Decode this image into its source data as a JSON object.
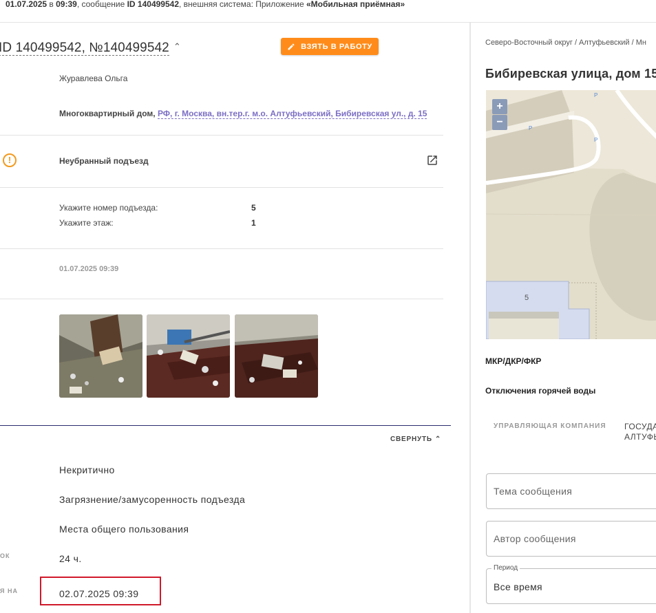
{
  "topbar": {
    "date": "01.07.2025",
    "in": " в ",
    "time": "09:39",
    "msg": ", сообщение ",
    "id": "ID 140499542",
    "ext": ", внешняя система: Приложение ",
    "system": "«Мобильная приёмная»"
  },
  "header": {
    "title": "ID 140499542, №140499542",
    "chevron": "⌃",
    "take_button": "ВЗЯТЬ В РАБОТУ"
  },
  "author": "Журавлева Ольга",
  "address": {
    "type": "Многоквартирный дом,",
    "link": "РФ, г. Москва, вн.тер.г. м.о. Алтуфьевский, Бибиревская ул., д. 15"
  },
  "problem": {
    "title": "Неубранный подъезд",
    "icon": "warning-icon"
  },
  "fields": [
    {
      "key": "Укажите номер подъезда:",
      "value": "5"
    },
    {
      "key": "Укажите этаж:",
      "value": "1"
    }
  ],
  "created_at": "01.07.2025 09:39",
  "collapse_label": "СВЕРНУТЬ",
  "details": {
    "priority": "Некритично",
    "category": "Загрязнение/замусоренность подъезда",
    "place": "Места общего пользования",
    "term_label": "ОК",
    "term": "24 ч.",
    "deadline_label": "Я НА",
    "deadline": "02.07.2025 09:39"
  },
  "right": {
    "breadcrumb": "Северо-Восточный округ / Алтуфьевский / Мн",
    "street": "Бибиревская улица, дом 15",
    "map": {
      "zoom_in": "+",
      "zoom_out": "−",
      "building_number": "5",
      "parking": "P"
    },
    "mkr": "МКР/ДКР/ФКР",
    "hot_water": "Отключения горячей воды",
    "tab_uk": "УПРАВЛЯЮЩАЯ КОМПАНИЯ",
    "tab_gos_1": "ГОСУДА",
    "tab_gos_2": "АЛТУФЬ",
    "topic_placeholder": "Тема сообщения",
    "author_placeholder": "Автор сообщения",
    "period_label": "Период",
    "period_value": "Все время"
  },
  "colors": {
    "accent_orange": "#ff8c1a",
    "link_purple": "#7b6ec4",
    "highlight_red": "#d0182a",
    "divider_navy": "#2a2a6e"
  }
}
